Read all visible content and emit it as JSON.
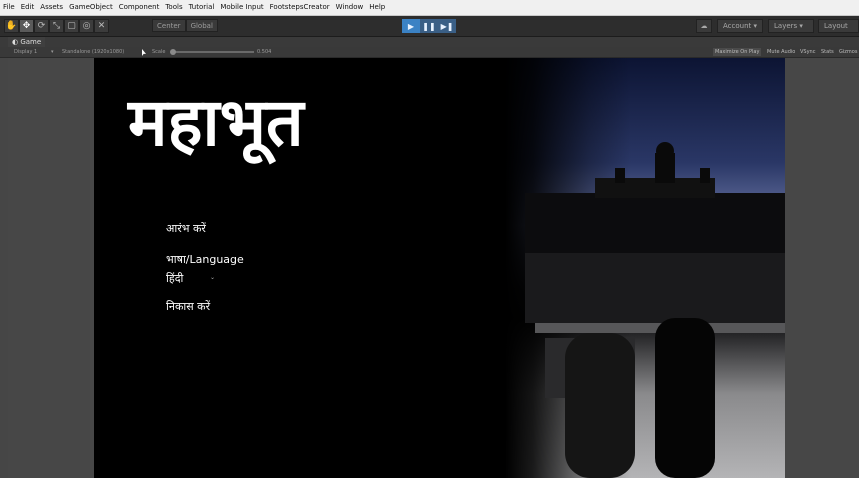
{
  "menubar": [
    "File",
    "Edit",
    "Assets",
    "GameObject",
    "Component",
    "Tools",
    "Tutorial",
    "Mobile Input",
    "FootstepsCreator",
    "Window",
    "Help"
  ],
  "toolbar": {
    "tools": [
      "hand-icon",
      "move-icon",
      "rotate-icon",
      "scale-icon",
      "rect-icon",
      "transform-icon",
      "custom-tool-icon"
    ],
    "center_label": "Center",
    "global_label": "Global",
    "play_label": "▶",
    "pause_label": "❚❚",
    "step_label": "▶❚",
    "account_label": "Account",
    "layers_label": "Layers",
    "layout_label": "Layout"
  },
  "game_view": {
    "tab_label": "Game",
    "display_label": "Display 1",
    "resolution_label": "Standalone (1920x1080)",
    "scale_label": "Scale",
    "scale_value": "0.504",
    "maximize_label": "Maximize On Play",
    "mute_label": "Mute Audio",
    "vsync_label": "VSync",
    "stats_label": "Stats",
    "gizmos_label": "Gizmos"
  },
  "game_ui": {
    "title": "महाभूत",
    "start_label": "आरंभ करें",
    "language_label": "भाषा/Language",
    "language_value": "हिंदी",
    "exit_label": "निकास करें"
  }
}
